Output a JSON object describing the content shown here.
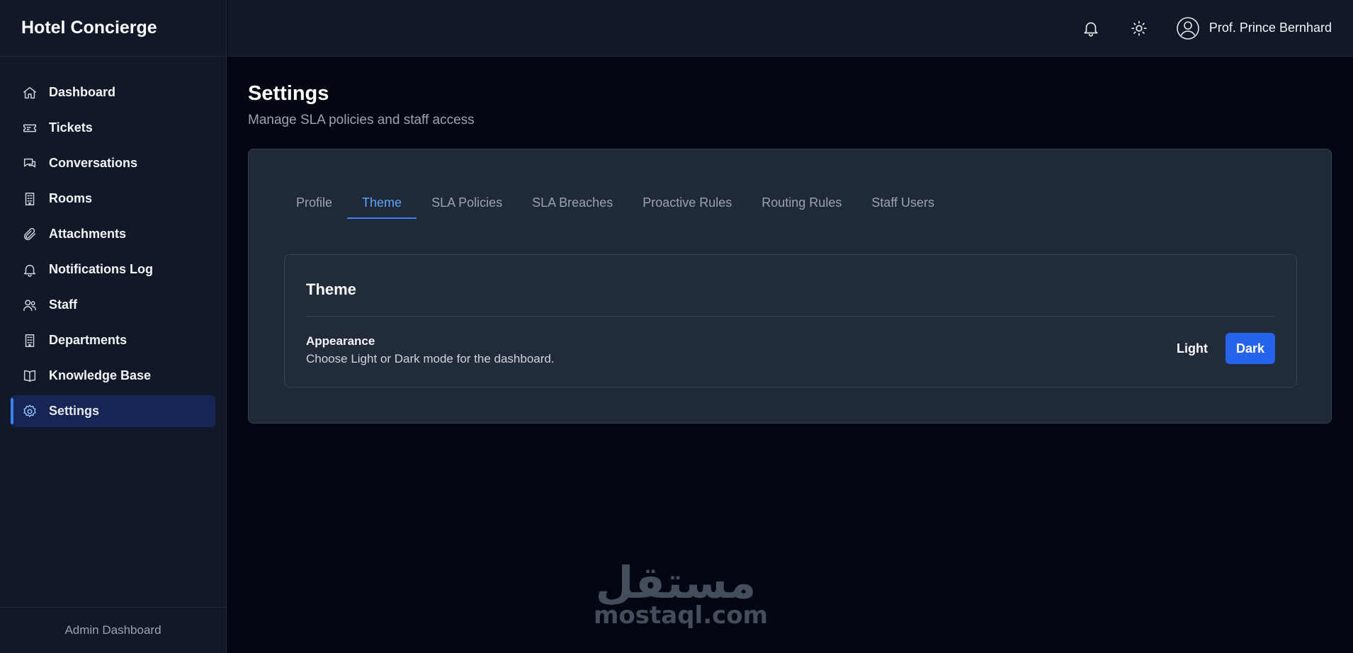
{
  "app": {
    "title": "Hotel Concierge"
  },
  "sidebar": {
    "items": [
      {
        "label": "Dashboard",
        "icon": "home-icon"
      },
      {
        "label": "Tickets",
        "icon": "ticket-icon"
      },
      {
        "label": "Conversations",
        "icon": "chat-icon"
      },
      {
        "label": "Rooms",
        "icon": "building-icon"
      },
      {
        "label": "Attachments",
        "icon": "paperclip-icon"
      },
      {
        "label": "Notifications Log",
        "icon": "bell-icon"
      },
      {
        "label": "Staff",
        "icon": "users-icon"
      },
      {
        "label": "Departments",
        "icon": "building-icon"
      },
      {
        "label": "Knowledge Base",
        "icon": "book-icon"
      },
      {
        "label": "Settings",
        "icon": "gear-icon",
        "active": true
      }
    ],
    "footer": "Admin Dashboard"
  },
  "topbar": {
    "user_name": "Prof. Prince Bernhard",
    "icons": [
      "bell-icon",
      "sun-icon",
      "user-circle-icon"
    ]
  },
  "page": {
    "title": "Settings",
    "subtitle": "Manage SLA policies and staff access"
  },
  "tabs": [
    {
      "label": "Profile"
    },
    {
      "label": "Theme",
      "active": true
    },
    {
      "label": "SLA Policies"
    },
    {
      "label": "SLA Breaches"
    },
    {
      "label": "Proactive Rules"
    },
    {
      "label": "Routing Rules"
    },
    {
      "label": "Staff Users"
    }
  ],
  "theme_card": {
    "title": "Theme",
    "setting_label": "Appearance",
    "setting_desc": "Choose Light or Dark mode for the dashboard.",
    "light_label": "Light",
    "dark_label": "Dark",
    "selected": "Dark"
  },
  "watermark": {
    "arabic": "مستقل",
    "latin": "mostaql.com"
  },
  "colors": {
    "accent": "#2563eb",
    "active_tab": "#60a5fa",
    "background": "#030712",
    "panel": "#1f2937"
  }
}
